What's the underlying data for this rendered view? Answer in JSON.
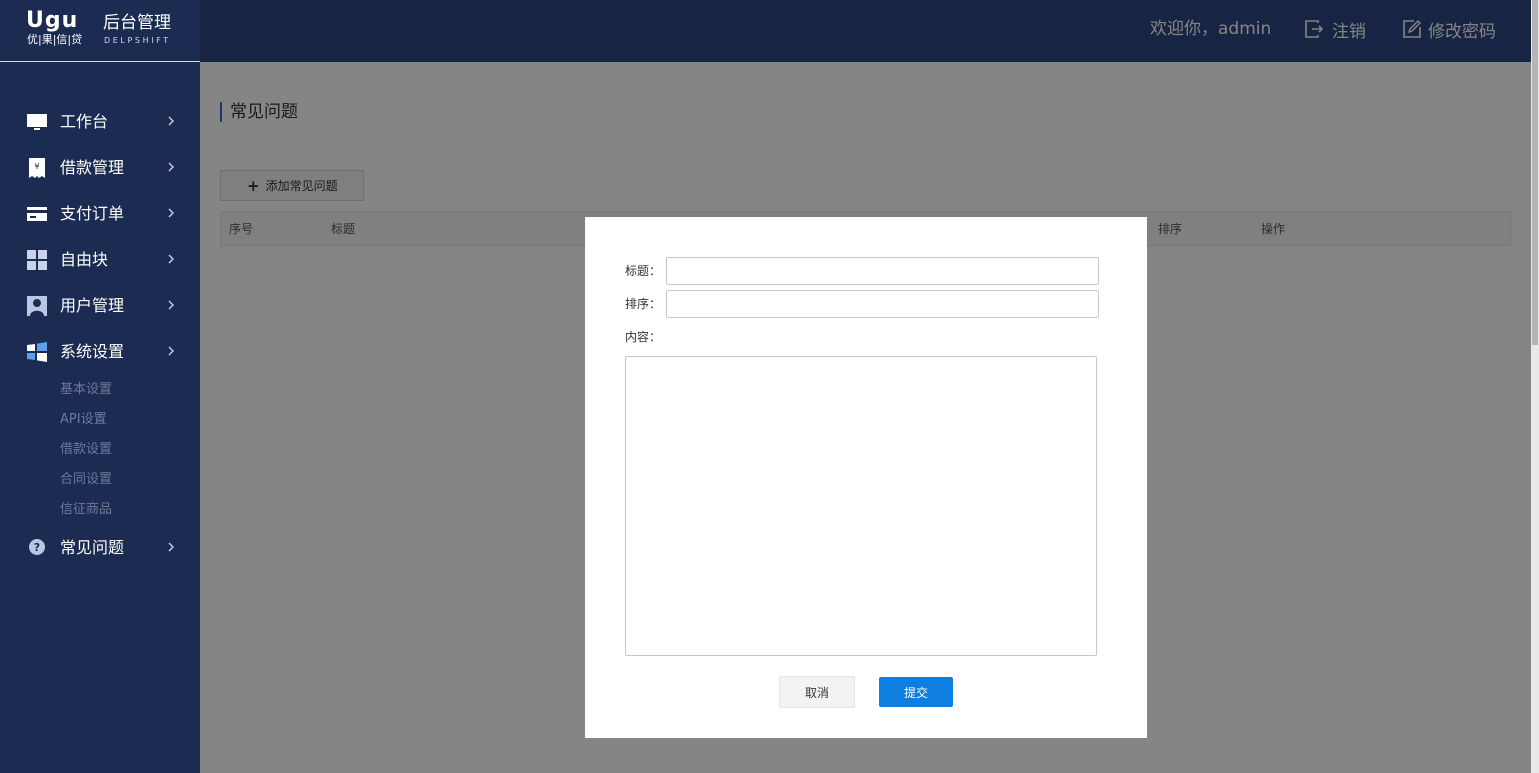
{
  "logo": {
    "mark": "Ugu",
    "sub": "优|果|信|贷",
    "title": "后台管理",
    "en": "DELPSHIFT"
  },
  "header": {
    "welcome": "欢迎你，admin",
    "logout": "注销",
    "change_password": "修改密码"
  },
  "sidebar": {
    "items": [
      {
        "label": "工作台",
        "icon": "monitor-icon"
      },
      {
        "label": "借款管理",
        "icon": "receipt-icon"
      },
      {
        "label": "支付订单",
        "icon": "card-icon"
      },
      {
        "label": "自由块",
        "icon": "grid-icon"
      },
      {
        "label": "用户管理",
        "icon": "user-icon"
      },
      {
        "label": "系统设置",
        "icon": "windows-icon"
      }
    ],
    "system_subitems": [
      "基本设置",
      "API设置",
      "借款设置",
      "合同设置",
      "信征商品"
    ],
    "faq": {
      "label": "常见问题",
      "icon": "question-icon"
    }
  },
  "main": {
    "page_title": "常见问题",
    "add_button": "添加常见问题",
    "table_headers": {
      "index": "序号",
      "title": "标题",
      "order": "排序",
      "action": "操作"
    }
  },
  "modal": {
    "title_label": "标题：",
    "title_value": "",
    "order_label": "排序：",
    "order_value": "",
    "content_label": "内容：",
    "content_value": "",
    "cancel": "取消",
    "submit": "提交"
  },
  "colors": {
    "sidebar_bg": "#1b2b52",
    "header_bg": "#2e4580",
    "submit_bg": "#0e7fe0",
    "overlay": "rgba(0,0,0,0.48)"
  }
}
